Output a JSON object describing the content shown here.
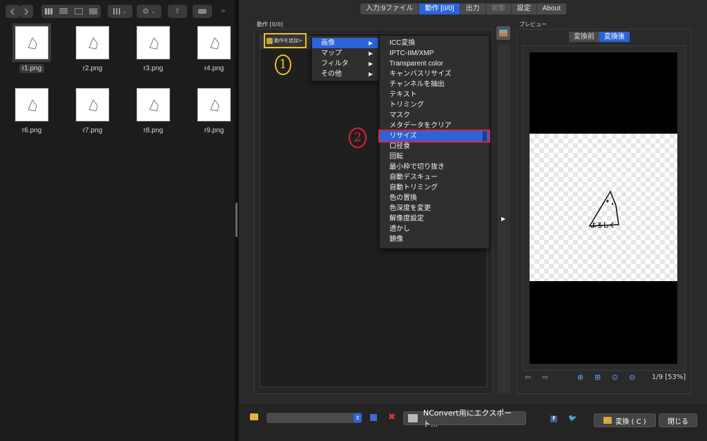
{
  "finder": {
    "files": [
      {
        "name": "r1.png",
        "selected": true
      },
      {
        "name": "r2.png"
      },
      {
        "name": "r3.png"
      },
      {
        "name": "r4.png"
      },
      {
        "name": "r6.png"
      },
      {
        "name": "r7.png"
      },
      {
        "name": "r8.png"
      },
      {
        "name": "r9.png"
      }
    ],
    "more_label": "»"
  },
  "app": {
    "tabs": [
      {
        "label": "入力:9ファイル"
      },
      {
        "label": "動作 [0/0]",
        "active": true
      },
      {
        "label": "出力"
      },
      {
        "label": "状態",
        "disabled": true
      },
      {
        "label": "設定"
      },
      {
        "label": "About"
      }
    ],
    "action_group_title": "動作 [0/0]",
    "add_action_label": "動作を追加>",
    "preview_group_title": "プレビュー",
    "preview_segments": [
      "変換前",
      "変換後"
    ],
    "preview_caption": "よろしく",
    "page_info": "1/9 [53%]"
  },
  "menu_main": [
    {
      "label": "画像",
      "highlight": true
    },
    {
      "label": "マップ"
    },
    {
      "label": "フィルタ"
    },
    {
      "label": "その他"
    }
  ],
  "menu_sub": [
    "ICC変換",
    "IPTC-IIM/XMP",
    "Transparent color",
    "キャンバスリサイズ",
    "チャンネルを抽出",
    "テキスト",
    "トリミング",
    "マスク",
    "メタデータをクリア",
    "リサイズ",
    "口径食",
    "回転",
    "最小枠で切り抜き",
    "自動デスキュー",
    "自動トリミング",
    "色の置換",
    "色深度を変更",
    "解像度設定",
    "透かし",
    "鏡像"
  ],
  "menu_sub_highlight_index": 9,
  "menu_arrow": "▶",
  "annotations": {
    "one": "1",
    "two": "2"
  },
  "bottom": {
    "export_label": "NConvert用にエクスポート...",
    "convert_label": "変換 ( C )",
    "close_label": "閉じる",
    "facebook_glyph": "f",
    "twitter_glyph": "🐦",
    "delete_glyph": "✖"
  },
  "colors": {
    "accent": "#2c63d8",
    "annotation_yellow": "#f0c020",
    "annotation_red": "#e02040"
  }
}
